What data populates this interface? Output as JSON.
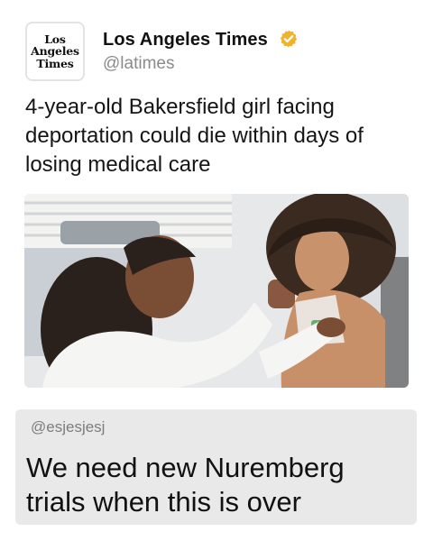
{
  "tweet": {
    "logo_lines": [
      "Los",
      "Angeles",
      "Times"
    ],
    "author_name": "Los Angeles Times",
    "author_handle": "@latimes",
    "verified": true,
    "headline": "4-year-old Bakersfield girl facing deportation could die within days of losing medical care"
  },
  "photo": {
    "icon": "news-photo"
  },
  "quote": {
    "handle": "@esjesjesj",
    "text": "We need new Nuremberg trials when this is over"
  },
  "colors": {
    "verified_badge": "#f1b22c",
    "handle_gray": "#8a8a8a",
    "quote_bg": "#e9e9e9"
  }
}
